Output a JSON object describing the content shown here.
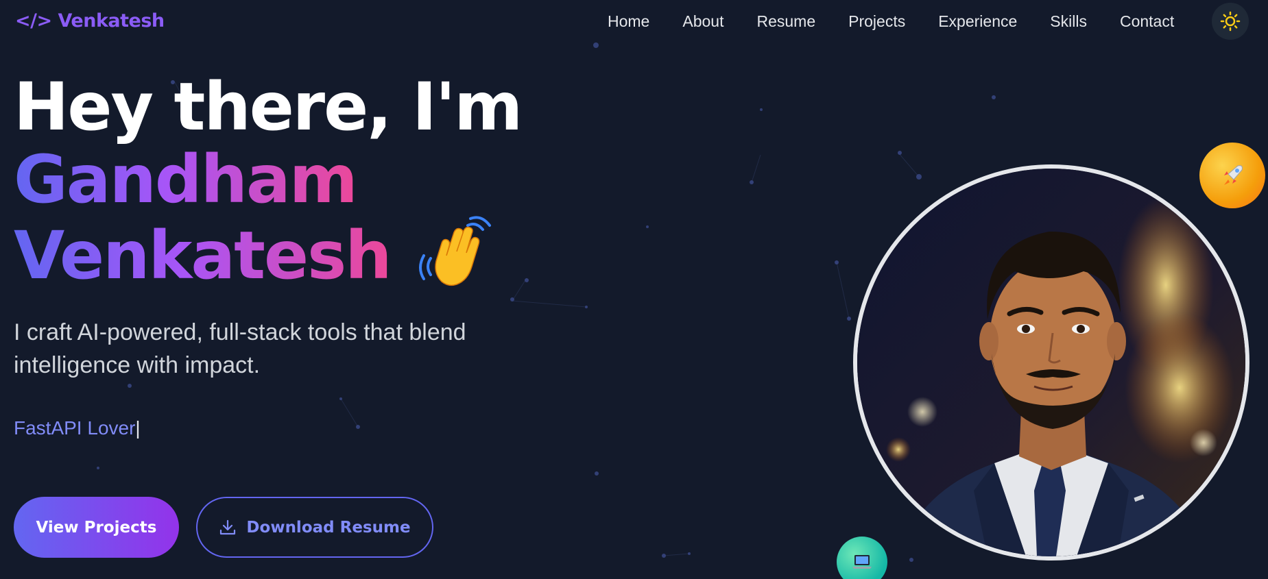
{
  "nav": {
    "logo": "</> Venkatesh",
    "links": [
      "Home",
      "About",
      "Resume",
      "Projects",
      "Experience",
      "Skills",
      "Contact"
    ],
    "theme_toggle_icon": "sun-icon"
  },
  "hero": {
    "greeting": "Hey there, I'm",
    "first_name": "Gandham",
    "last_name": "Venkatesh",
    "wave_icon": "waving-hand-icon",
    "tagline": "I craft AI-powered, full-stack tools that blend intelligence with impact.",
    "typed_text": "FastAPI Lover",
    "cursor": "|",
    "primary_button": "View Projects",
    "secondary_button": "Download Resume",
    "secondary_button_icon": "download-icon"
  },
  "profile": {
    "photo": "profile-photo",
    "badges": [
      "rocket-icon",
      "laptop-icon"
    ]
  },
  "colors": {
    "background": "#131a2b",
    "accent_indigo": "#6366f1",
    "accent_purple": "#a855f7",
    "accent_pink": "#ec4899",
    "logo": "#8b5cf6",
    "typed": "#818cf8",
    "sun": "#facc15"
  }
}
